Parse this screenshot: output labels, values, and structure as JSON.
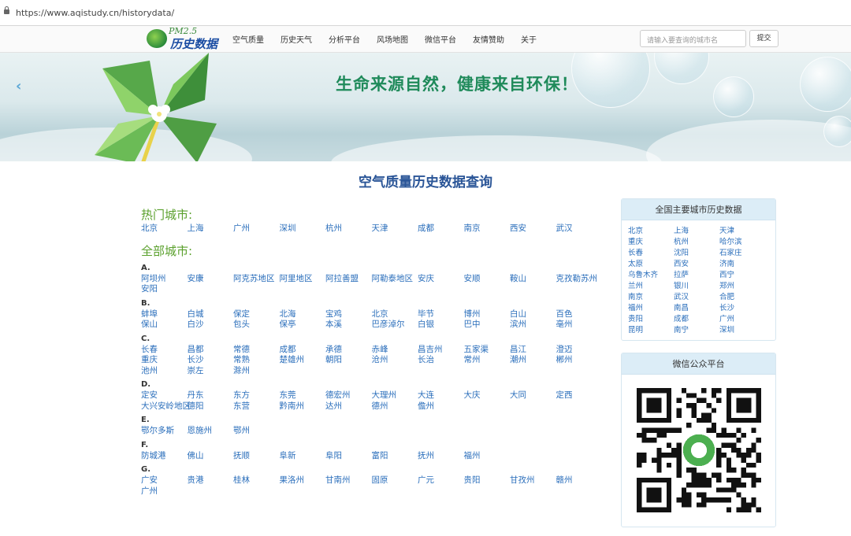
{
  "browser": {
    "url": "https://www.aqistudy.cn/historydata/"
  },
  "logo": {
    "pm": "PM2.5",
    "text": "历史数据"
  },
  "nav": {
    "items": [
      "空气质量",
      "历史天气",
      "分析平台",
      "风场地图",
      "微信平台",
      "友情赞助",
      "关于"
    ]
  },
  "search": {
    "placeholder": "请输入要查询的城市名",
    "submit_label": "提交"
  },
  "banner": {
    "slogan": "生命来源自然，健康来自环保！",
    "prev_arrow": "‹"
  },
  "page_title": "空气质量历史数据查询",
  "hot": {
    "title": "热门城市:",
    "cities": [
      "北京",
      "上海",
      "广州",
      "深圳",
      "杭州",
      "天津",
      "成都",
      "南京",
      "西安",
      "武汉"
    ]
  },
  "all": {
    "title": "全部城市:",
    "groups": [
      {
        "letter": "A.",
        "cities": [
          "阿坝州",
          "安康",
          "阿克苏地区",
          "阿里地区",
          "阿拉善盟",
          "阿勒泰地区",
          "安庆",
          "安顺",
          "鞍山",
          "克孜勒苏州",
          "安阳"
        ]
      },
      {
        "letter": "B.",
        "cities": [
          "蚌埠",
          "白城",
          "保定",
          "北海",
          "宝鸡",
          "北京",
          "毕节",
          "博州",
          "白山",
          "百色",
          "保山",
          "白沙",
          "包头",
          "保亭",
          "本溪",
          "巴彦淖尔",
          "白银",
          "巴中",
          "滨州",
          "亳州"
        ]
      },
      {
        "letter": "C.",
        "cities": [
          "长春",
          "昌都",
          "常德",
          "成都",
          "承德",
          "赤峰",
          "昌吉州",
          "五家渠",
          "昌江",
          "澄迈",
          "重庆",
          "长沙",
          "常熟",
          "楚雄州",
          "朝阳",
          "沧州",
          "长治",
          "常州",
          "潮州",
          "郴州",
          "池州",
          "崇左",
          "滁州"
        ]
      },
      {
        "letter": "D.",
        "cities": [
          "定安",
          "丹东",
          "东方",
          "东莞",
          "德宏州",
          "大理州",
          "大连",
          "大庆",
          "大同",
          "定西",
          "大兴安岭地区",
          "德阳",
          "东营",
          "黔南州",
          "达州",
          "德州",
          "儋州"
        ]
      },
      {
        "letter": "E.",
        "cities": [
          "鄂尔多斯",
          "恩施州",
          "鄂州"
        ]
      },
      {
        "letter": "F.",
        "cities": [
          "防城港",
          "佛山",
          "抚顺",
          "阜新",
          "阜阳",
          "富阳",
          "抚州",
          "福州"
        ]
      },
      {
        "letter": "G.",
        "cities": [
          "广安",
          "贵港",
          "桂林",
          "果洛州",
          "甘南州",
          "固原",
          "广元",
          "贵阳",
          "甘孜州",
          "赣州",
          "广州"
        ]
      }
    ]
  },
  "side": {
    "major_title": "全国主要城市历史数据",
    "major_cities": [
      "北京",
      "上海",
      "天津",
      "重庆",
      "杭州",
      "哈尔滨",
      "长春",
      "沈阳",
      "石家庄",
      "太原",
      "西安",
      "济南",
      "乌鲁木齐",
      "拉萨",
      "西宁",
      "兰州",
      "银川",
      "郑州",
      "南京",
      "武汉",
      "合肥",
      "福州",
      "南昌",
      "长沙",
      "贵阳",
      "成都",
      "广州",
      "昆明",
      "南宁",
      "深圳"
    ],
    "wechat_title": "微信公众平台"
  }
}
